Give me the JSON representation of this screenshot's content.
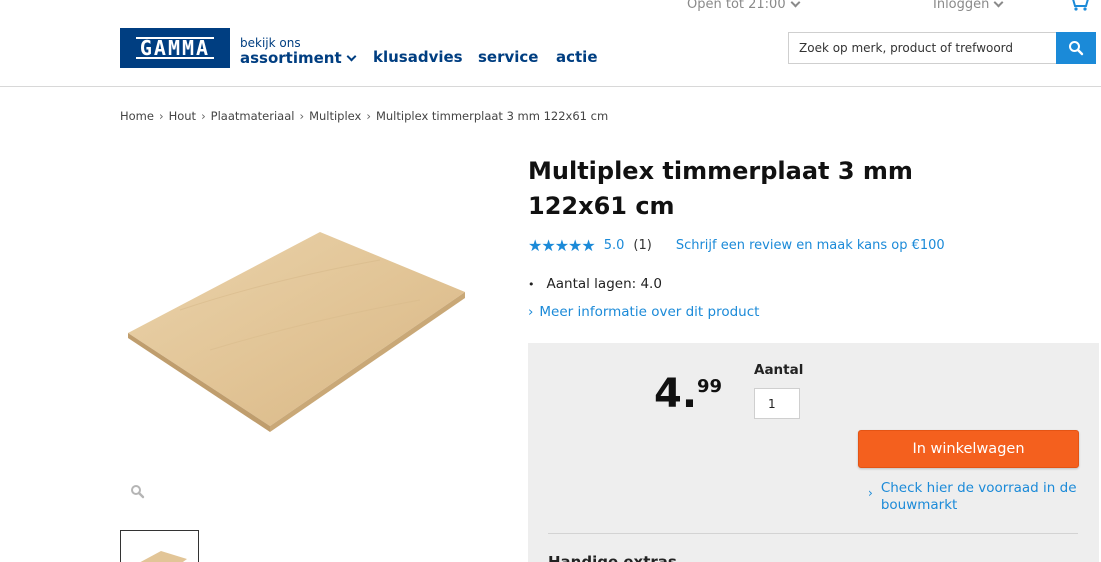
{
  "header": {
    "opening_hours": "Open tot 21:00",
    "login": "Inloggen",
    "logo_text": "GAMMA",
    "assortment_small": "bekijk ons",
    "assortment_big": "assortiment",
    "nav": [
      "klusadvies",
      "service",
      "actie"
    ],
    "search_placeholder": "Zoek op merk, product of trefwoord",
    "colors": {
      "brand": "#003e81",
      "accent": "#1b8ad8",
      "cta": "#f4601e"
    }
  },
  "breadcrumb": [
    "Home",
    "Hout",
    "Plaatmateriaal",
    "Multiplex",
    "Multiplex timmerplaat 3 mm 122x61 cm"
  ],
  "product": {
    "title": "Multiplex timmerplaat 3 mm 122x61 cm",
    "stars": "★★★★★",
    "rating_value": "5.0",
    "rating_count": "(1)",
    "review_link": "Schrijf een review en maak kans op €100",
    "spec": "Aantal lagen: 4.0",
    "more_info": "Meer informatie over dit product",
    "icons": [
      "zoom-icon",
      "search-icon",
      "cart-icon",
      "chevron-down-icon"
    ]
  },
  "buy": {
    "price_int": "4.",
    "price_dec": "99",
    "qty_label": "Aantal",
    "qty_value": "1",
    "cart_button": "In winkelwagen",
    "stock_link": "Check hier de voorraad in de bouwmarkt",
    "section_heading": "Handige extras"
  }
}
